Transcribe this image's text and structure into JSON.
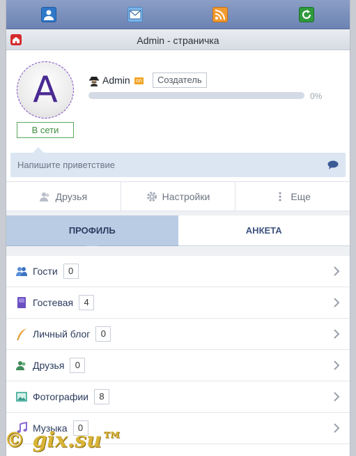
{
  "topbar": {
    "icons": [
      "user-icon",
      "mail-icon",
      "rss-icon",
      "refresh-icon"
    ]
  },
  "header": {
    "title": "Admin - страничка",
    "home_icon": "home-icon"
  },
  "profile": {
    "avatar_letter": "A",
    "status": "В сети",
    "username": "Admin",
    "online_badge": "on",
    "role": "Создатель",
    "progress_percent": 0,
    "progress_label": "0%"
  },
  "greeting": {
    "placeholder": "Напишите приветствие"
  },
  "actions": [
    {
      "label": "Друзья",
      "icon": "friends-icon"
    },
    {
      "label": "Настройки",
      "icon": "gear-icon"
    },
    {
      "label": "Еще",
      "icon": "more-icon"
    }
  ],
  "tabs": [
    {
      "label": "ПРОФИЛЬ",
      "active": true
    },
    {
      "label": "АНКЕТА",
      "active": false
    }
  ],
  "menu": [
    {
      "label": "Гости",
      "count": "0",
      "icon": "guests-icon"
    },
    {
      "label": "Гостевая",
      "count": "4",
      "icon": "guestbook-icon"
    },
    {
      "label": "Личный блог",
      "count": "0",
      "icon": "blog-icon"
    },
    {
      "label": "Друзья",
      "count": "0",
      "icon": "friends-icon"
    },
    {
      "label": "Фотографии",
      "count": "8",
      "icon": "photos-icon"
    },
    {
      "label": "Музыка",
      "count": "0",
      "icon": "music-icon"
    }
  ],
  "watermark": "© gix.su™",
  "colors": {
    "topbar": "#7a8fbd",
    "accent": "#b9cce4",
    "online": "#3f8f3f",
    "link": "#2a3a5c"
  }
}
